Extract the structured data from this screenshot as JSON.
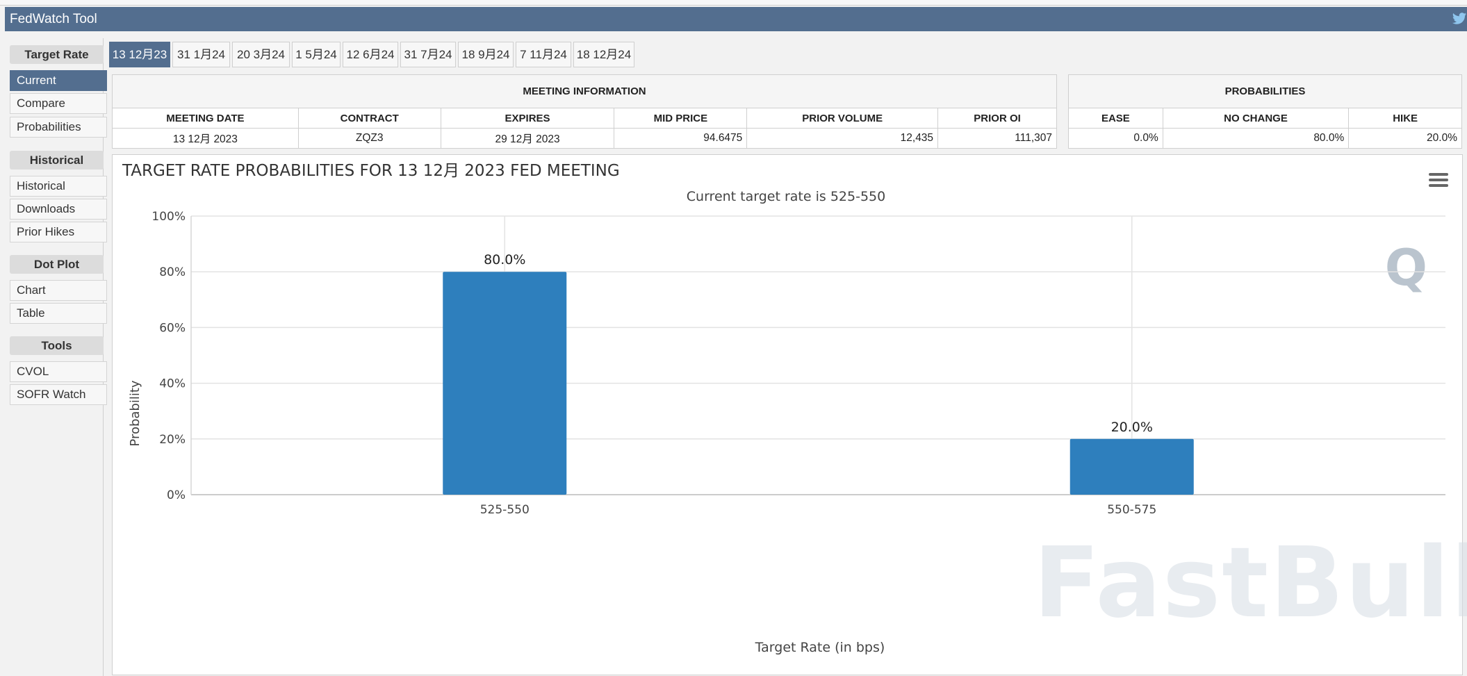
{
  "app": {
    "title": "FedWatch Tool",
    "twitter_icon": "twitter-bird-icon"
  },
  "sidebar": {
    "sections": [
      {
        "heading": "Target Rate",
        "items": [
          "Current",
          "Compare",
          "Probabilities"
        ],
        "active": 0
      },
      {
        "heading": "Historical",
        "items": [
          "Historical",
          "Downloads",
          "Prior Hikes"
        ],
        "active": -1
      },
      {
        "heading": "Dot Plot",
        "items": [
          "Chart",
          "Table"
        ],
        "active": -1
      },
      {
        "heading": "Tools",
        "items": [
          "CVOL",
          "SOFR Watch"
        ],
        "active": -1
      }
    ]
  },
  "tabs": {
    "items": [
      "13 12月23",
      "31 1月24",
      "20 3月24",
      "1 5月24",
      "12 6月24",
      "31 7月24",
      "18 9月24",
      "7 11月24",
      "18 12月24"
    ],
    "active": 0
  },
  "meeting_info": {
    "title": "MEETING INFORMATION",
    "headers": [
      "MEETING DATE",
      "CONTRACT",
      "EXPIRES",
      "MID PRICE",
      "PRIOR VOLUME",
      "PRIOR OI"
    ],
    "values": [
      "13 12月 2023",
      "ZQZ3",
      "29 12月 2023",
      "94.6475",
      "12,435",
      "111,307"
    ]
  },
  "probabilities": {
    "title": "PROBABILITIES",
    "headers": [
      "EASE",
      "NO CHANGE",
      "HIKE"
    ],
    "values": [
      "0.0%",
      "80.0%",
      "20.0%"
    ]
  },
  "chart": {
    "menu_icon": "hamburger-menu-icon",
    "watermark": "FastBull",
    "logo": "Q"
  },
  "chart_data": {
    "type": "bar",
    "title": "TARGET RATE PROBABILITIES FOR 13 12月 2023 FED MEETING",
    "subtitle": "Current target rate is 525-550",
    "xlabel": "Target Rate (in bps)",
    "ylabel": "Probability",
    "categories": [
      "525-550",
      "550-575"
    ],
    "values": [
      80.0,
      20.0
    ],
    "data_labels": [
      "80.0%",
      "20.0%"
    ],
    "ylim": [
      0,
      100
    ],
    "yticks": [
      "0%",
      "20%",
      "40%",
      "60%",
      "80%",
      "100%"
    ],
    "bar_color": "#2e7fbd",
    "grid": true
  }
}
